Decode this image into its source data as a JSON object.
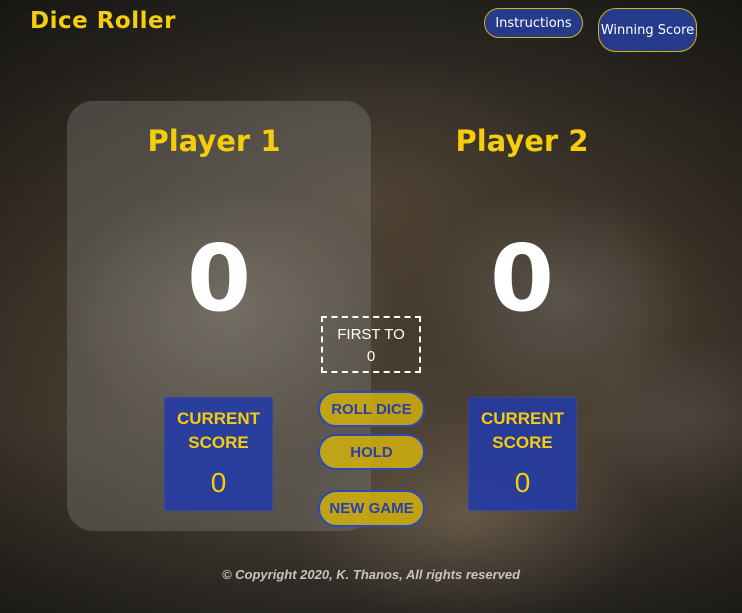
{
  "header": {
    "title": "Dice Roller",
    "instructions_label": "Instructions",
    "winning_score_label": "Winning Score"
  },
  "players": [
    {
      "name": "Player 1",
      "total": "0",
      "current_label": "CURRENT SCORE",
      "current": "0",
      "active": true
    },
    {
      "name": "Player 2",
      "total": "0",
      "current_label": "CURRENT SCORE",
      "current": "0",
      "active": false
    }
  ],
  "goal": {
    "label": "FIRST TO",
    "value": "0"
  },
  "controls": {
    "roll_label": "ROLL DICE",
    "hold_label": "HOLD",
    "new_game_label": "NEW GAME"
  },
  "footer": {
    "copyright": "© Copyright 2020, K. Thanos, All rights reserved"
  },
  "colors": {
    "accent_yellow": "#f5cd0c",
    "button_blue": "#263a8c",
    "score_box_blue": "#213aaa"
  }
}
